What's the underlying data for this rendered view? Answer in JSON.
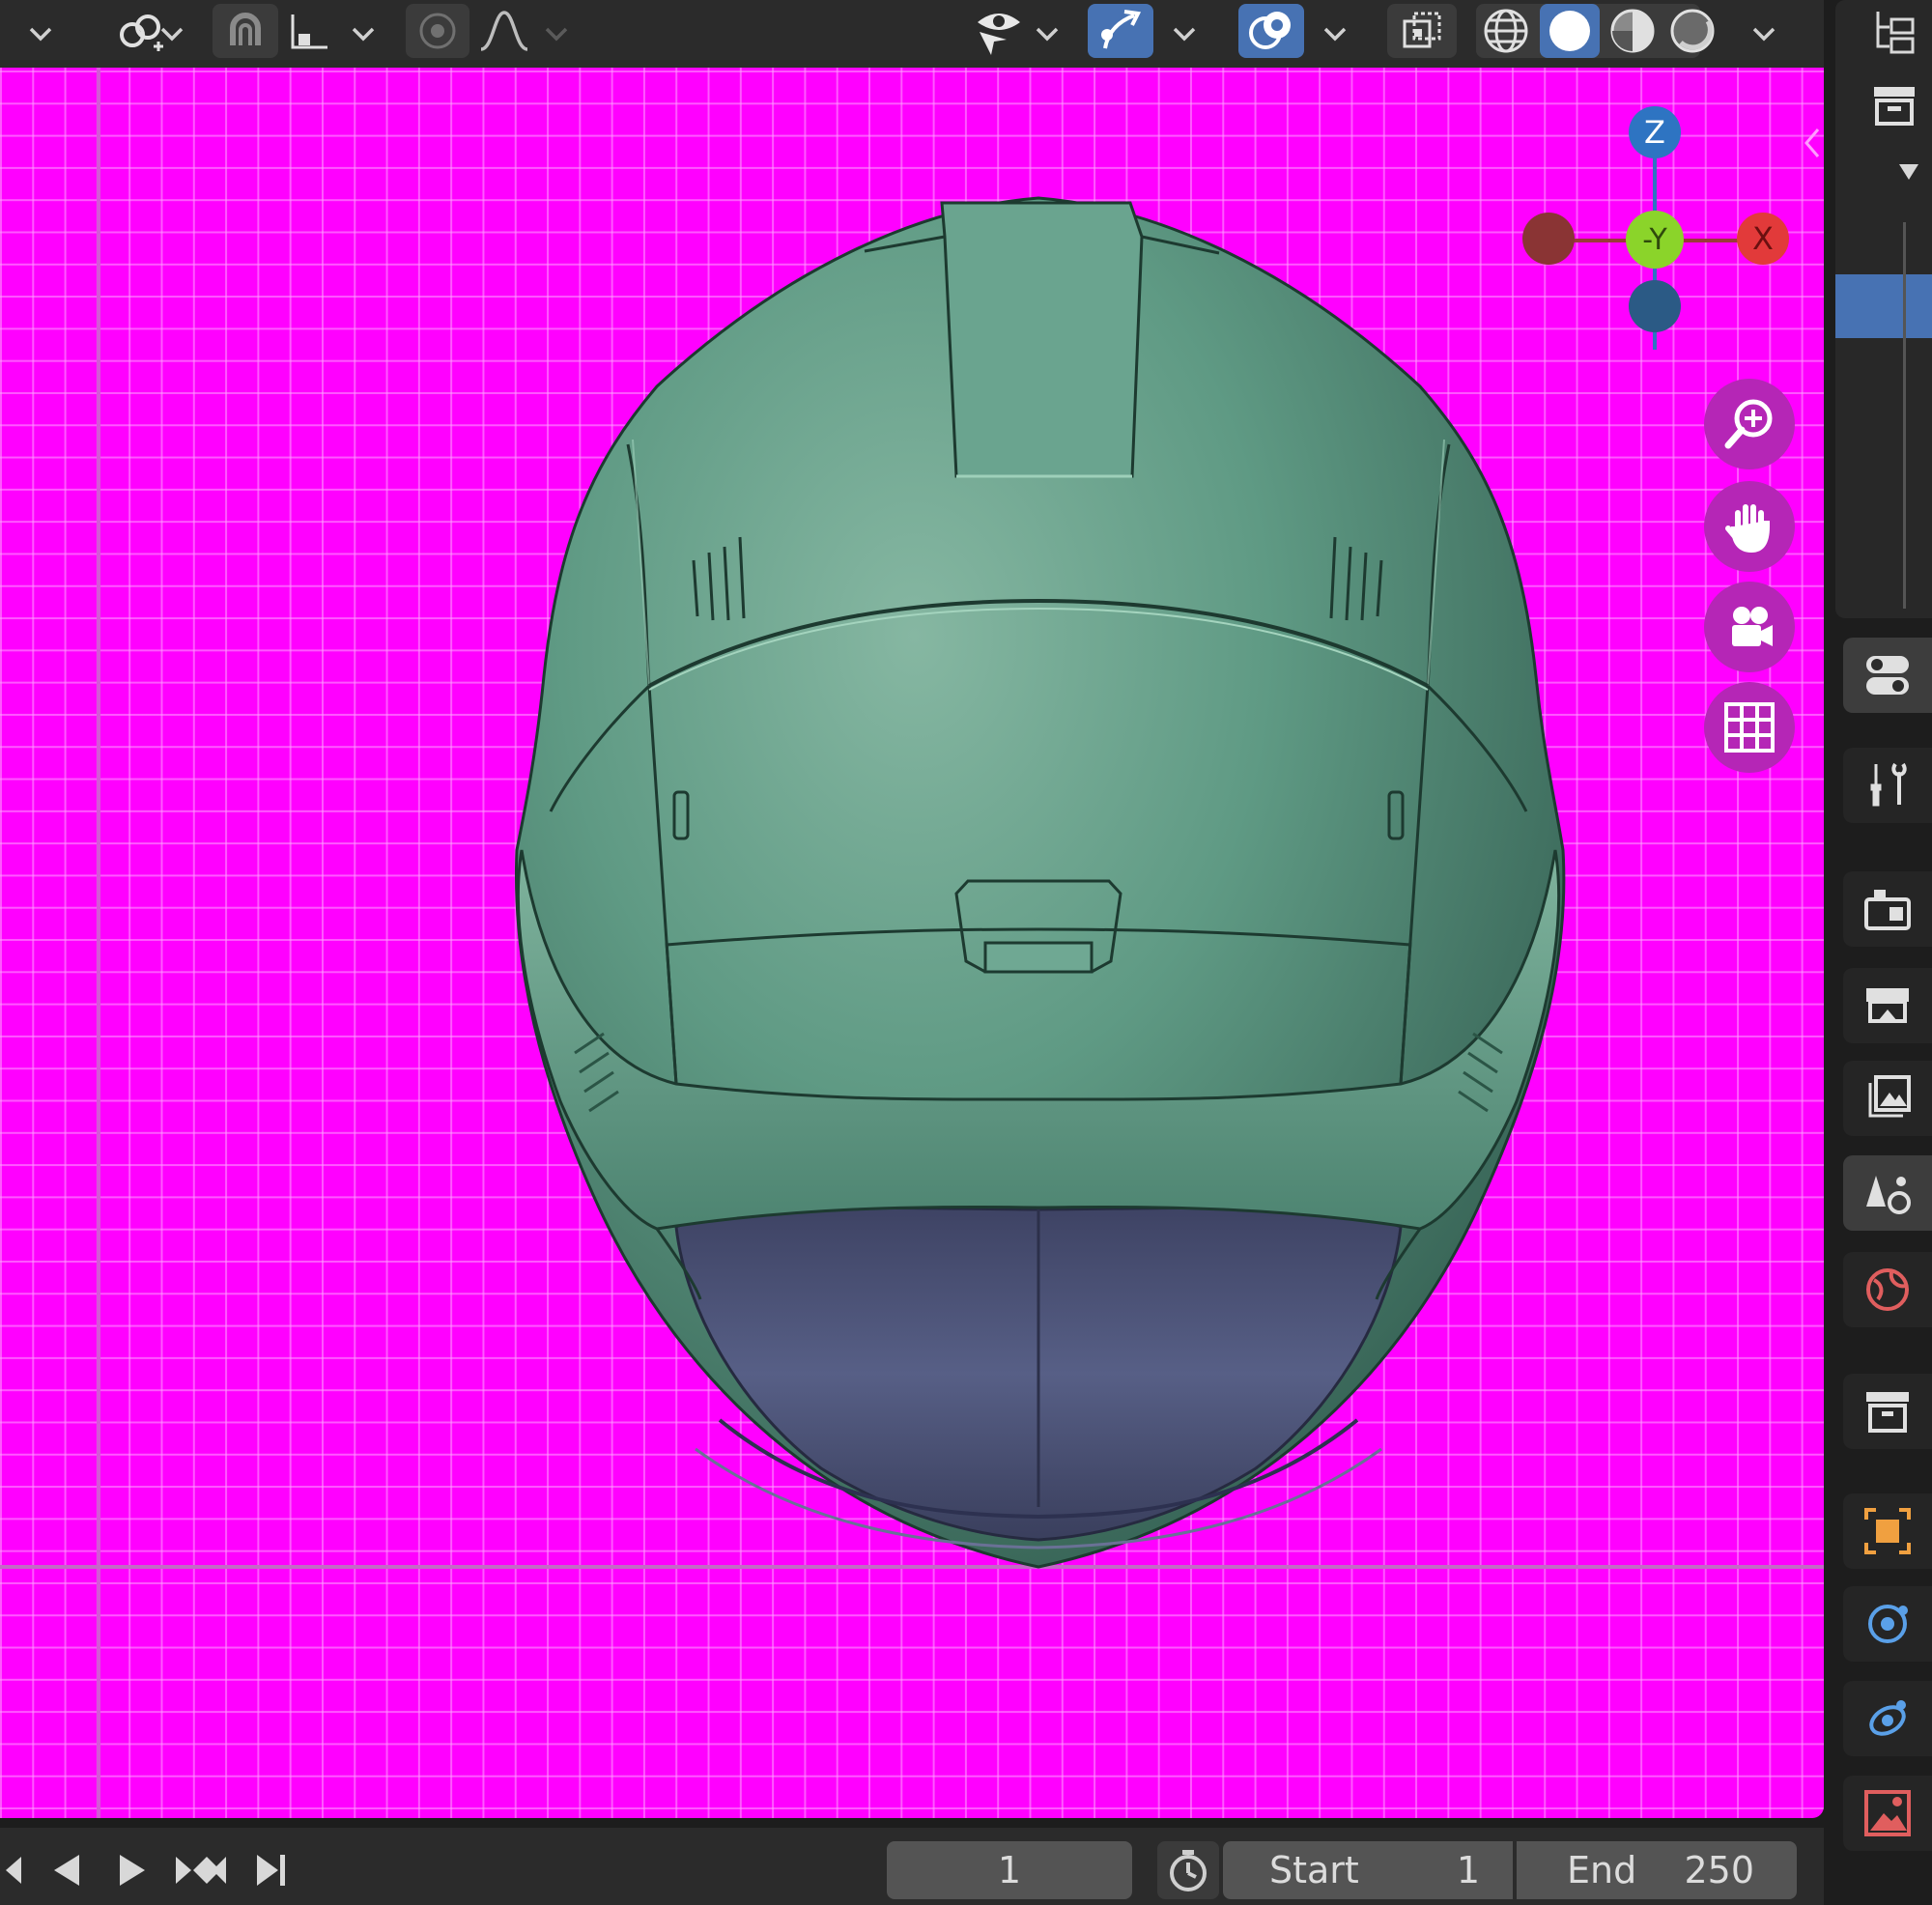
{
  "viewport": {
    "background_color": "#ff00ff",
    "gizmo": {
      "z_label": "Z",
      "y_label": "-Y",
      "x_label": "X"
    }
  },
  "timeline": {
    "current_frame": "1",
    "start_label": "Start",
    "start_value": "1",
    "end_label": "End",
    "end_value": "250"
  },
  "colors": {
    "accent": "#4772b3",
    "helmet_shell": "#5f9a84",
    "visor": "#535a80",
    "nav_button": "#b526b6"
  }
}
